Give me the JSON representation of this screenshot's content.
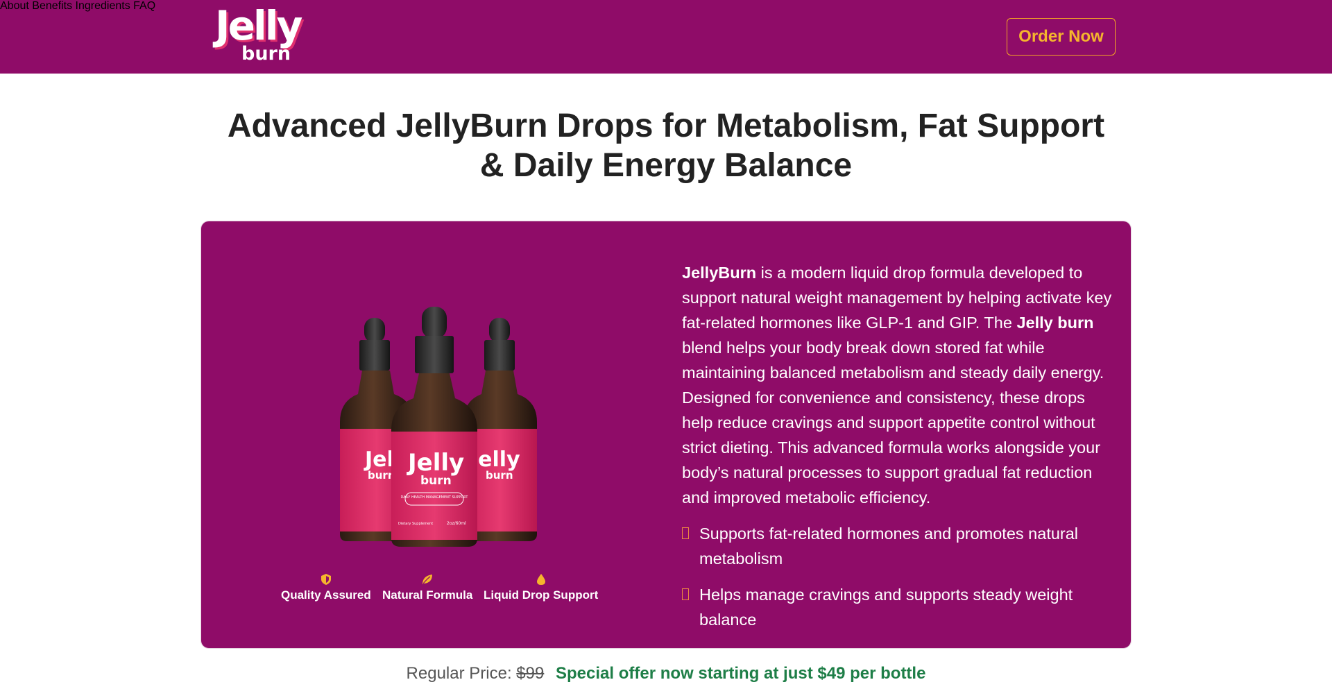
{
  "header": {
    "logo": {
      "line1": "Jelly",
      "line2": "burn"
    },
    "nav": [
      "About",
      "Benefits",
      "Ingredients",
      "FAQ"
    ],
    "order_label": "Order Now"
  },
  "hero": {
    "headline_line1": "Advanced JellyBurn Drops for Metabolism, Fat Support",
    "headline_line2": "& Daily Energy Balance"
  },
  "product": {
    "bottle_label": {
      "brand1": "Jelly",
      "brand2": "burn",
      "tagline": "DAILY HEALTH MANAGEMENT SUPPORT",
      "kind": "Dietary Supplement",
      "size": "2oz/60ml"
    },
    "badges": [
      {
        "icon": "shield-icon",
        "label": "Quality Assured"
      },
      {
        "icon": "leaf-icon",
        "label": "Natural Formula"
      },
      {
        "icon": "drop-icon",
        "label": "Liquid Drop Support"
      }
    ],
    "description": {
      "brand": "JellyBurn",
      "part1": " is a modern liquid drop formula developed to support natural weight management by helping activate key fat-related hormones like GLP-1 and GIP. The ",
      "brand2": "Jelly burn",
      "part2": " blend helps your body break down stored fat while maintaining balanced metabolism and steady daily energy. Designed for convenience and consistency, these drops help reduce cravings and support appetite control without strict dieting. This advanced formula works alongside your body’s natural processes to support gradual fat reduction and improved metabolic efficiency."
    },
    "bullets": [
      "Supports fat-related hormones and promotes natural metabolism",
      "Helps manage cravings and supports steady weight balance"
    ]
  },
  "pricing": {
    "regular_label": "Regular Price:",
    "regular_value": "$99",
    "offer": "Special offer now starting at just $49 per bottle"
  },
  "colors": {
    "brand_purple": "#8f0c68",
    "accent_orange": "#f5b52d",
    "offer_green": "#1e7e47",
    "bottle_red": "#e0306e"
  }
}
